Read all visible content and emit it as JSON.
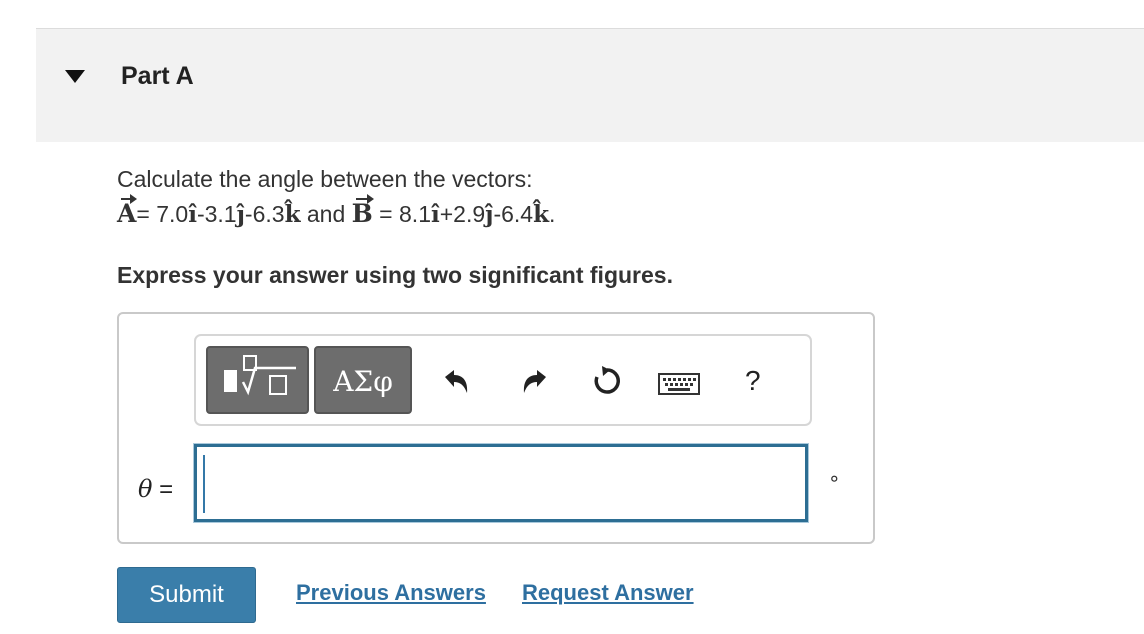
{
  "part": {
    "title": "Part A"
  },
  "question": {
    "text": "Calculate the angle between the vectors:",
    "vector_a_symbol": "A",
    "vector_a_value": "= 7.0",
    "vector_a_i": "ı̂",
    "vector_a_j_coef": "-3.1",
    "vector_a_j": "ȷ̂",
    "vector_a_k_coef": "-6.3",
    "vector_a_k": "k̂",
    "connector": " and ",
    "vector_b_symbol": "B",
    "vector_b_value": " = 8.1",
    "vector_b_i": "ı̂",
    "vector_b_j_coef": "+2.9",
    "vector_b_j": "ȷ̂",
    "vector_b_k_coef": "-6.4",
    "vector_b_k": "k̂",
    "end": ".",
    "instruction": "Express your answer using two significant figures."
  },
  "toolbar": {
    "symbols_label": "ΑΣφ",
    "help_label": "?",
    "icons": [
      "templates-icon",
      "undo-icon",
      "redo-icon",
      "reset-icon",
      "keyboard-icon",
      "help-icon"
    ]
  },
  "answer": {
    "variable": "θ",
    "equals": "=",
    "value": "",
    "unit": "∘"
  },
  "actions": {
    "submit_label": "Submit",
    "previous_answers_label": "Previous Answers",
    "request_answer_label": "Request Answer"
  },
  "colors": {
    "header_bg": "#f2f2f2",
    "submit_bg": "#3a7eaa",
    "link": "#2e6fa0",
    "toolbar_button": "#6d6d6d",
    "input_border": "#2d6e93"
  }
}
